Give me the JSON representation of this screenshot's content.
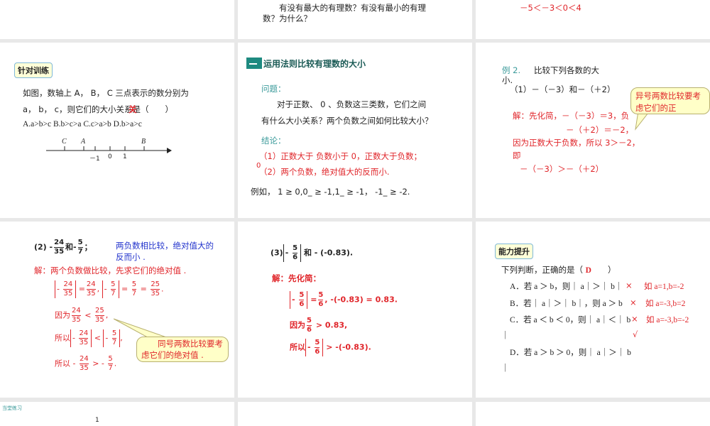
{
  "top": {
    "c2_line1": "有没有最大的有理数？有没有最小的有理",
    "c2_line2": "数？为什么？",
    "c3_line": "－5＜－3＜0＜4"
  },
  "s1": {
    "badge": "针对训练",
    "line1": "如图，数轴上 A， B， C 三点表示的数分别为",
    "line2": "a， b， c，则它们的大小关系是（　　）",
    "mark": "关",
    "options": "A.a>b>c   B.b>c>a   C.c>a>b   D.b>a>c",
    "points": {
      "C": "C",
      "A": "A",
      "B": "B"
    },
    "ticks": [
      "－1",
      "0",
      "1"
    ]
  },
  "s2": {
    "title": "运用法则比较有理数的大小",
    "q_label": "问题：",
    "q1": "对于正数、 0 、负数这三类数，它们之间",
    "q2": "有什么大小关系？两个负数之间如何比较大小？",
    "c_label": "结论：",
    "c1": "（1）正数大于  负数小于 0，正数大于负数；",
    "c_sup": "0",
    "c2": "（2）两个负数，绝对值大的反而小.",
    "example": "例如， 1  ≥   0,0_ ≥ -1,1_ ≥  -1， -1_ ≥  -2."
  },
  "s3": {
    "ex_label": "例 2.",
    "ex_text": "比较下列各数的大",
    "ex_text2": "小.",
    "q1": "（1）－（－3）和－（＋2）",
    "callout": "异号两数比较要考虑它们的正",
    "l1": "解：先化简，－（－3）＝3，负",
    "l2": "－（＋2）＝－2，",
    "l3": "因为正数大于负数，所以 3＞－2，",
    "l4": "即",
    "l5": "－（－3）＞－（＋2）"
  },
  "s4": {
    "q_prefix": "(2) -",
    "n1": "24",
    "d1": "35",
    "and": "和-",
    "n2": "5",
    "d2": "7",
    "semi": "；",
    "note": "两负数相比较，绝对值大的反而小 .",
    "sol": "解：两个负数做比较，先求它们的绝对值 .",
    "n3": "25",
    "because": "因为",
    "so": "所以",
    "callout": "同号两数比较要考虑它们的绝对值 ."
  },
  "s5": {
    "q_prefix": "(3)",
    "n": "5",
    "d": "6",
    "q_suffix": "和 - (-0.83).",
    "sol": "解：先化简：",
    "r1": ", -(-0.83) = 0.83.",
    "because": "因为",
    "r2": "> 0.83,",
    "so": "所以",
    "r3": "> -(-0.83)."
  },
  "s6": {
    "badge": "能力提升",
    "q": "下列判断，正确的是（",
    "answer": "D",
    "q_end": "）",
    "A": "A．若 a ＞ b，则｜ a｜＞｜ b｜",
    "B": "B．若｜ a｜＞｜ b｜，则 a ＞ b",
    "C": "C．若 a ＜ b ＜ 0，则｜ a｜＜｜ b",
    "C2": "｜",
    "D": "D．若 a ＞ b ＞ 0，则｜ a｜＞｜ b",
    "D2": "｜",
    "xA": "×",
    "xB": "×",
    "xC": "×",
    "check": "√",
    "egA": "如 a=1,b=-2",
    "egB": "如 a=-3,b=2",
    "egC": "如 a=-3,b=-2"
  },
  "bottom": {
    "label": "当堂练习",
    "partial": "1"
  }
}
